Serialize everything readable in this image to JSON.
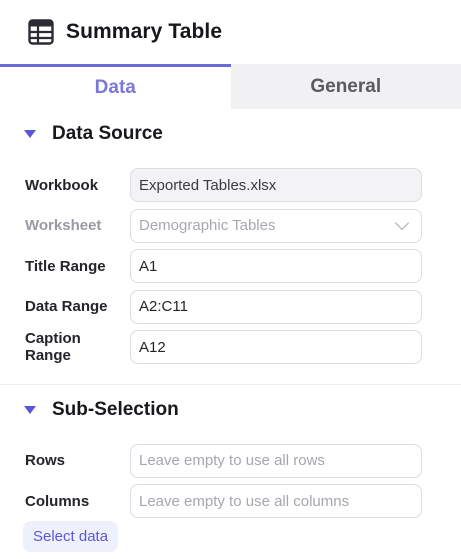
{
  "header": {
    "title": "Summary Table",
    "icon": "table-icon"
  },
  "tabs": [
    {
      "label": "Data",
      "active": true
    },
    {
      "label": "General",
      "active": false
    }
  ],
  "data_source": {
    "title": "Data Source",
    "workbook": {
      "label": "Workbook",
      "value": "Exported Tables.xlsx"
    },
    "worksheet": {
      "label": "Worksheet",
      "value": "Demographic Tables"
    },
    "title_range": {
      "label": "Title Range",
      "value": "A1"
    },
    "data_range": {
      "label": "Data Range",
      "value": "A2:C11"
    },
    "caption_range": {
      "label": "Caption Range",
      "value": "A12"
    }
  },
  "sub_selection": {
    "title": "Sub-Selection",
    "rows": {
      "label": "Rows",
      "placeholder": "Leave empty to use all rows"
    },
    "columns": {
      "label": "Columns",
      "placeholder": "Leave empty to use all columns"
    },
    "select_button": "Select data"
  },
  "colors": {
    "accent": "#6c69d8",
    "tab_inactive_bg": "#f1f1f4",
    "button_bg": "#eef0fb"
  }
}
